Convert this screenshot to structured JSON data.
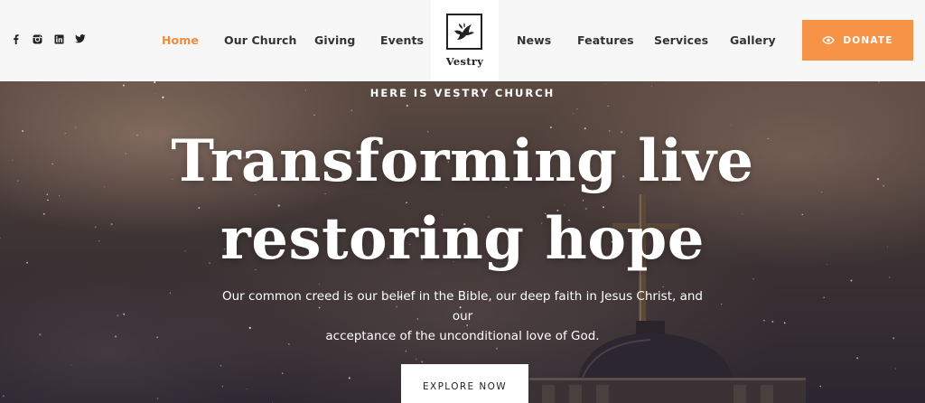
{
  "header": {
    "social": [
      {
        "icon": "facebook-icon"
      },
      {
        "icon": "instagram-icon"
      },
      {
        "icon": "linkedin-icon"
      },
      {
        "icon": "twitter-icon"
      }
    ],
    "nav": [
      {
        "label": "Home",
        "active": true
      },
      {
        "label": "Our Church"
      },
      {
        "label": "Giving"
      },
      {
        "label": "Events"
      },
      {
        "label": "News"
      },
      {
        "label": "Features"
      },
      {
        "label": "Services"
      },
      {
        "label": "Gallery"
      }
    ],
    "logo": {
      "text": "Vestry",
      "icon": "dove-icon"
    },
    "donate": {
      "label": "DONATE",
      "icon": "eye-icon"
    }
  },
  "hero": {
    "eyebrow": "HERE IS VESTRY CHURCH",
    "headline_line1": "Transforming live",
    "headline_line2": "restoring hope",
    "subtitle_line1": "Our common creed is our belief in the Bible, our deep faith in Jesus Christ, and our",
    "subtitle_line2": "acceptance of the unconditional love of God.",
    "cta": "EXPLORE NOW"
  },
  "colors": {
    "accent": "#f79346",
    "active_nav": "#f08c3c",
    "header_bg": "#f7f7f7"
  }
}
